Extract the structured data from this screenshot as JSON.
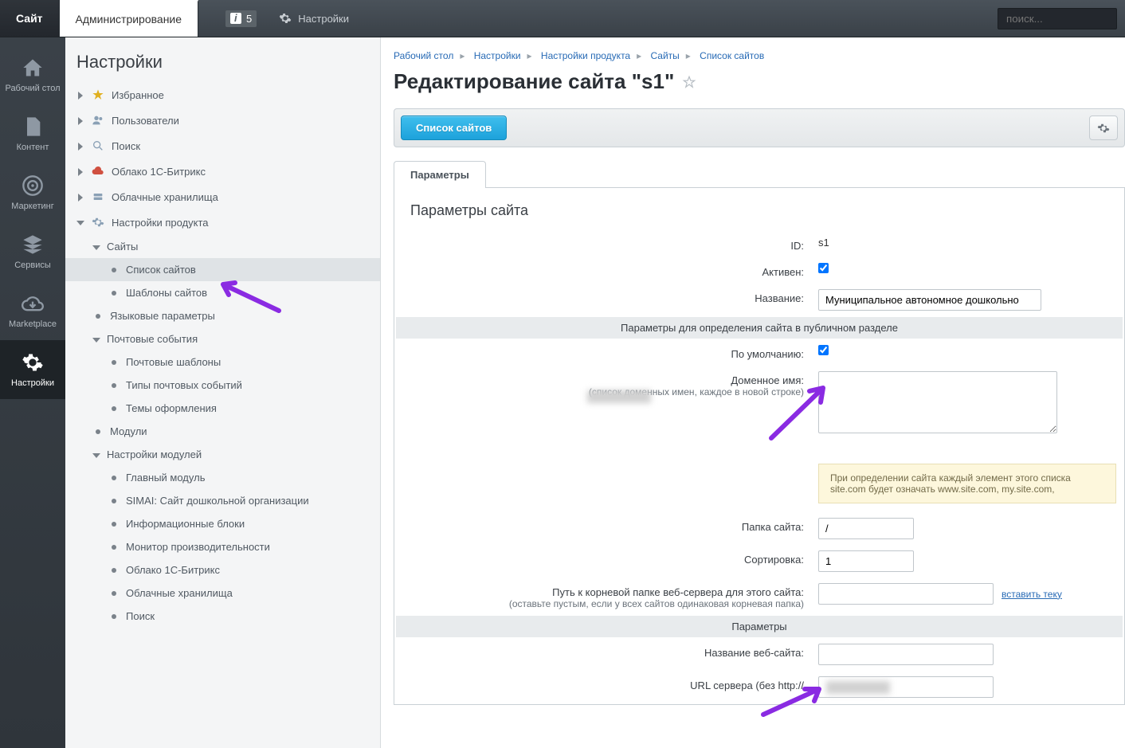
{
  "topbar": {
    "site_tab": "Сайт",
    "admin_tab": "Администрирование",
    "notif_count": "5",
    "settings_label": "Настройки",
    "search_placeholder": "поиск..."
  },
  "rail": [
    {
      "label": "Рабочий стол",
      "icon": "home"
    },
    {
      "label": "Контент",
      "icon": "doc"
    },
    {
      "label": "Маркетинг",
      "icon": "target"
    },
    {
      "label": "Сервисы",
      "icon": "layers"
    },
    {
      "label": "Marketplace",
      "icon": "cloud"
    },
    {
      "label": "Настройки",
      "icon": "gear"
    }
  ],
  "sidebar": {
    "title": "Настройки",
    "items": {
      "fav": "Избранное",
      "users": "Пользователи",
      "search": "Поиск",
      "cloud1c": "Облако 1С-Битрикс",
      "cloudstorage": "Облачные хранилища",
      "prodsettings": "Настройки продукта",
      "sites": "Сайты",
      "sitelist": "Список сайтов",
      "sitetemplates": "Шаблоны сайтов",
      "langparams": "Языковые параметры",
      "mailevents": "Почтовые события",
      "mailtpl": "Почтовые шаблоны",
      "mailevtypes": "Типы почтовых событий",
      "themes": "Темы оформления",
      "modules": "Модули",
      "modsettings": "Настройки модулей",
      "mainmod": "Главный модуль",
      "simai": "SIMAI: Сайт дошкольной организации",
      "iblock": "Информационные блоки",
      "perfmon": "Монитор производительности",
      "cloud1c2": "Облако 1С-Битрикс",
      "cloudstor2": "Облачные хранилища",
      "search2": "Поиск"
    }
  },
  "breadcrumb": [
    "Рабочий стол",
    "Настройки",
    "Настройки продукта",
    "Сайты",
    "Список сайтов"
  ],
  "page_title": "Редактирование сайта \"s1\"",
  "toolbar": {
    "back_btn": "Список сайтов"
  },
  "tabs": {
    "params": "Параметры"
  },
  "form": {
    "section_title": "Параметры сайта",
    "id_label": "ID:",
    "id_value": "s1",
    "active_label": "Активен:",
    "name_label": "Название:",
    "name_value": "Муниципальное автономное дошкольно",
    "pub_section_header": "Параметры для определения сайта в публичном разделе",
    "default_label": "По умолчанию:",
    "domain_label": "Доменное имя:",
    "domain_hint": "(список доменных имен, каждое в новой строке)",
    "note_text": "При определении сайта каждый элемент этого списка site.com будет означать www.site.com, my.site.com, ",
    "folder_label": "Папка сайта:",
    "folder_value": "/",
    "sort_label": "Сортировка:",
    "sort_value": "1",
    "root_label": "Путь к корневой папке веб-сервера для этого сайта:",
    "root_hint": "(оставьте пустым, если у всех сайтов одинаковая корневая папка)",
    "insert_link": "вставить теку",
    "params_header": "Параметры",
    "webname_label": "Название веб-сайта:",
    "url_label": "URL сервера (без http://"
  }
}
